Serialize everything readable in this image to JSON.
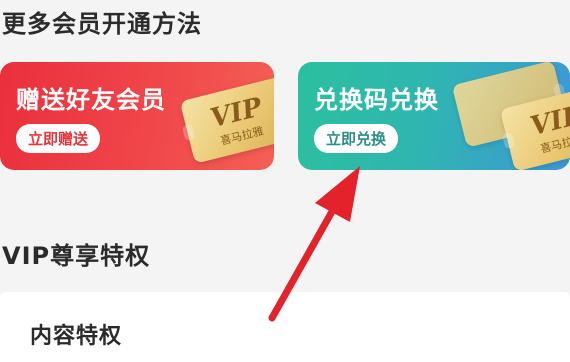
{
  "sections": {
    "more_methods_title": "更多会员开通方法",
    "vip_privileges_title": "VIP尊享特权",
    "content_privilege_title": "内容特权"
  },
  "cards": {
    "gift": {
      "title": "赠送好友会员",
      "button": "立即赠送",
      "ticket_text": "VIP",
      "ticket_brand": "喜马拉雅"
    },
    "redeem": {
      "title": "兑换码兑换",
      "button": "立即兑换",
      "ticket_text": "VIP",
      "ticket_brand": "喜马拉雅"
    }
  },
  "colors": {
    "gift_card": "#ea2f3c",
    "redeem_card": "#2cbf9f",
    "arrow": "#e4222b",
    "ticket_gold": "#e9c771"
  }
}
